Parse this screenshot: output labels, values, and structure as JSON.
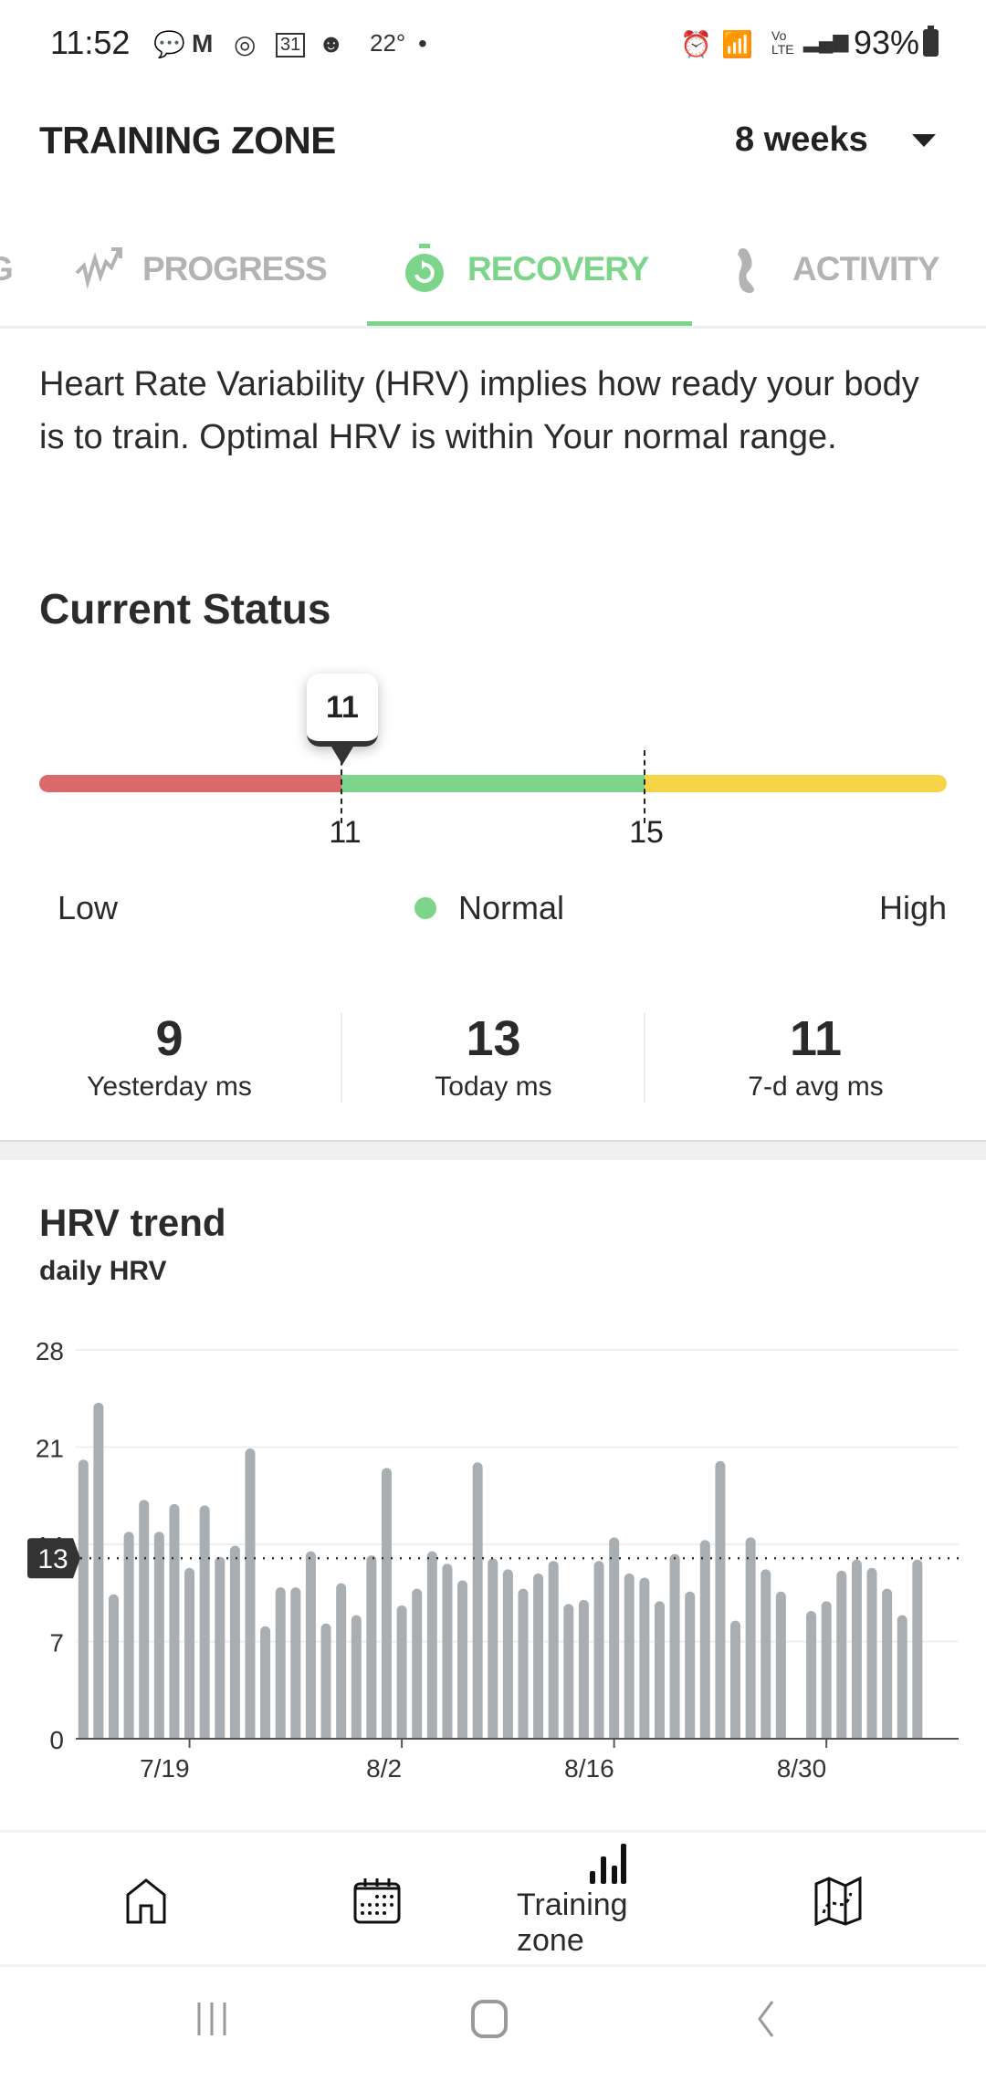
{
  "status_bar": {
    "time": "11:52",
    "temperature": "22°",
    "battery": "93%",
    "icons": [
      "chat-icon",
      "gmail-icon",
      "handshake-icon",
      "calendar-icon",
      "alien-icon",
      "alarm-icon",
      "wifi-icon",
      "volte-icon",
      "signal-icon",
      "battery-icon"
    ]
  },
  "header": {
    "title": "TRAINING ZONE",
    "range": "8 weeks"
  },
  "tabs": [
    {
      "label": "G",
      "icon": "partial-tab"
    },
    {
      "label": "PROGRESS",
      "icon": "trend-arrow-icon"
    },
    {
      "label": "RECOVERY",
      "icon": "stopwatch-icon",
      "active": true
    },
    {
      "label": "ACTIVITY",
      "icon": "footprint-icon"
    }
  ],
  "description": "Heart Rate Variability (HRV) implies how ready your body is to train. Optimal HRV is within Your normal range.",
  "current_status": {
    "heading": "Current Status",
    "value": "11",
    "thresholds": [
      "11",
      "15"
    ],
    "legend": {
      "low": "Low",
      "normal": "Normal",
      "high": "High"
    },
    "colors": {
      "low": "#d9696b",
      "normal": "#7dd58b",
      "high": "#f5d547"
    }
  },
  "stats": [
    {
      "value": "9",
      "label": "Yesterday ms"
    },
    {
      "value": "13",
      "label": "Today ms"
    },
    {
      "value": "11",
      "label": "7-d avg ms"
    }
  ],
  "trend": {
    "title": "HRV trend",
    "subtitle": "daily HRV"
  },
  "chart_data": {
    "type": "bar",
    "ylim": [
      0,
      28
    ],
    "yticks": [
      "0",
      "7",
      "14",
      "21",
      "28"
    ],
    "grid": true,
    "reference_line": {
      "value": 13,
      "label": "13"
    },
    "xtick_labels": [
      "7/19",
      "8/2",
      "8/16",
      "8/30"
    ],
    "bar_color": "#a8aeb1",
    "x": [
      "7/12",
      "7/13",
      "7/14",
      "7/15",
      "7/16",
      "7/17",
      "7/18",
      "7/19",
      "7/20",
      "7/21",
      "7/22",
      "7/23",
      "7/24",
      "7/25",
      "7/26",
      "7/27",
      "7/28",
      "7/29",
      "7/30",
      "7/31",
      "8/1",
      "8/2",
      "8/3",
      "8/4",
      "8/5",
      "8/6",
      "8/7",
      "8/8",
      "8/9",
      "8/10",
      "8/11",
      "8/12",
      "8/13",
      "8/14",
      "8/15",
      "8/16",
      "8/17",
      "8/18",
      "8/19",
      "8/20",
      "8/21",
      "8/22",
      "8/23",
      "8/24",
      "8/25",
      "8/26",
      "8/27",
      "8/28",
      "8/29",
      "8/30",
      "8/31",
      "9/1",
      "9/2",
      "9/3",
      "9/4",
      "9/5"
    ],
    "values": [
      20.1,
      24.2,
      10.4,
      14.9,
      17.2,
      14.9,
      16.9,
      12.3,
      16.8,
      13.1,
      13.9,
      20.9,
      8.1,
      10.9,
      10.9,
      13.5,
      8.3,
      11.2,
      8.9,
      13.2,
      19.5,
      9.6,
      10.8,
      13.5,
      12.6,
      11.4,
      19.9,
      13.0,
      12.2,
      10.8,
      11.9,
      12.8,
      9.7,
      10.0,
      12.8,
      14.5,
      11.9,
      11.6,
      9.9,
      13.3,
      10.6,
      14.3,
      20.0,
      8.5,
      14.5,
      12.2,
      10.6,
      null,
      9.2,
      9.9,
      12.1,
      12.9,
      12.3,
      10.8,
      8.9,
      12.9
    ]
  },
  "bottom_nav": {
    "items": [
      {
        "icon": "home-icon"
      },
      {
        "icon": "calendar-icon"
      },
      {
        "icon": "bar-chart-icon",
        "label": "Training zone",
        "active": true
      },
      {
        "icon": "map-icon"
      }
    ]
  }
}
